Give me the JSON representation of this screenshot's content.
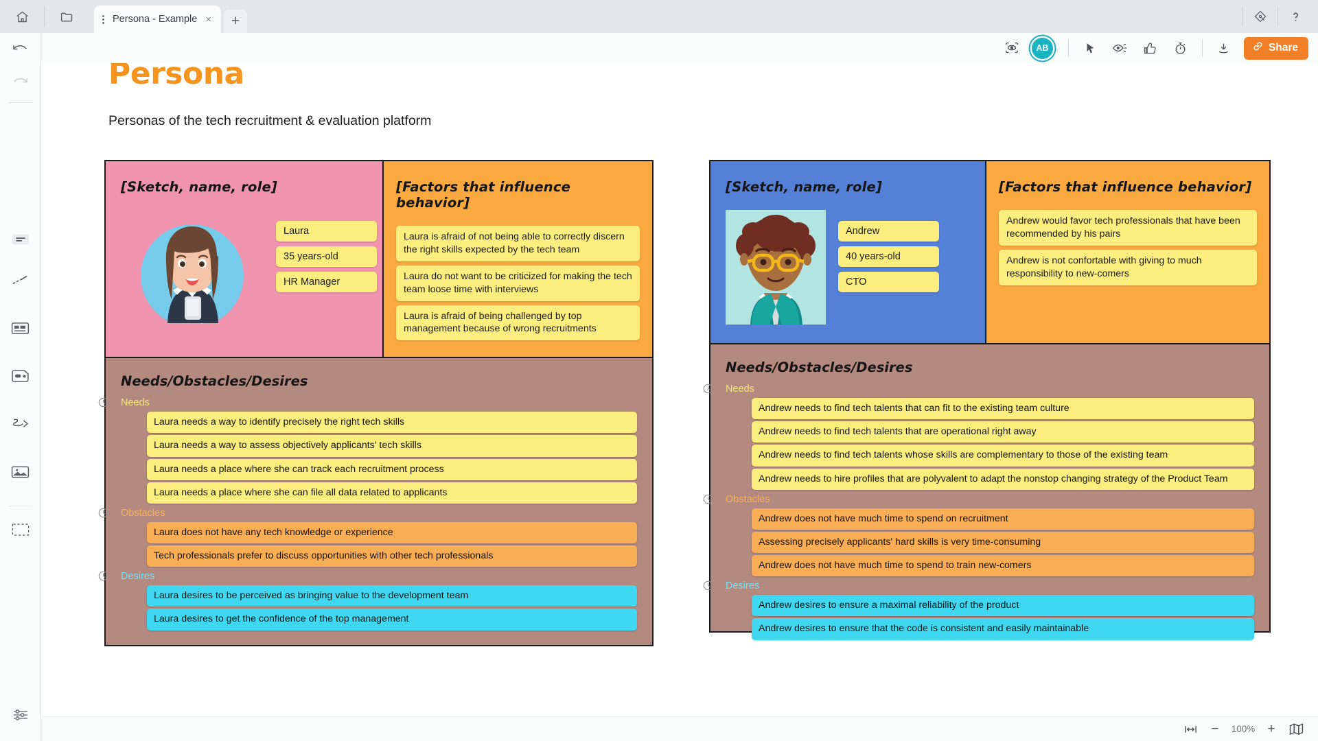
{
  "window": {
    "home_icon": "home-icon",
    "folder_icon": "folder-icon",
    "tab_title": "Persona - Example",
    "tab_close": "×",
    "new_tab": "+",
    "diamond_icon": "diamond-icon",
    "help_icon": "help-question-icon"
  },
  "toolbar": {
    "present_icon": "presentation-frame-icon",
    "avatar_initials": "AB",
    "cursor_icon": "cursor-pointer-icon",
    "eye_icon": "eye-trail-icon",
    "like_icon": "thumbs-up-icon",
    "timer_icon": "timer-icon",
    "download_icon": "download-icon",
    "share_label": "Share",
    "share_color": "#f07f27",
    "accent_color": "#1ab3c2"
  },
  "sidebar": {
    "items": [
      {
        "name": "undo-icon"
      },
      {
        "name": "redo-icon"
      },
      {
        "name": "sticky-note-icon"
      },
      {
        "name": "line-icon"
      },
      {
        "name": "card-icon"
      },
      {
        "name": "tag-icon"
      },
      {
        "name": "freehand-icon"
      },
      {
        "name": "image-icon"
      },
      {
        "name": "frame-icon"
      },
      {
        "name": "settings-sliders-icon"
      }
    ]
  },
  "canvas": {
    "title": "Persona",
    "title_color": "#f7941e",
    "subtitle": "Personas of the tech recruitment & evaluation platform"
  },
  "labels": {
    "sketch_head": "[Sketch, name, role]",
    "factors_head": "[Factors that influence behavior]",
    "nod_head": "Needs/Obstacles/Desires",
    "needs": "Needs",
    "obstacles": "Obstacles",
    "desires": "Desires"
  },
  "colors": {
    "pink_panel": "#f094b0",
    "blue_panel": "#5580d8",
    "orange_panel": "#f9a93f",
    "brown_panel": "#b4897f",
    "sticky_yellow": "#fbed7e",
    "sticky_orange": "#f9ae56",
    "sticky_cyan": "#3fd8f0"
  },
  "personas": [
    {
      "id": "laura",
      "name": "Laura",
      "age": "35 years-old",
      "role": "HR Manager",
      "factors": [
        "Laura is afraid of not being able to correctly discern the right skills expected by the tech team",
        "Laura do not want to be criticized for making the tech team loose time with interviews",
        "Laura is afraid of being challenged by top management because of wrong recruitments"
      ],
      "needs": [
        "Laura needs a way to identify precisely the right tech skills",
        "Laura needs a way to assess objectively applicants' tech skills",
        "Laura needs a place where she can track each recruitment process",
        "Laura needs a place where she can file all data related to applicants"
      ],
      "obstacles": [
        "Laura does not have any tech knowledge or experience",
        "Tech professionals prefer to discuss opportunities with other tech professionals"
      ],
      "desires": [
        "Laura desires to be perceived as bringing value to the development team",
        "Laura desires to get the confidence of the top management"
      ]
    },
    {
      "id": "andrew",
      "name": "Andrew",
      "age": "40 years-old",
      "role": "CTO",
      "factors": [
        "Andrew would favor tech professionals that have been recommended by his pairs",
        "Andrew is not confortable with giving to much responsibility to new-comers"
      ],
      "needs": [
        "Andrew needs to find tech talents that can fit to the existing team culture",
        "Andrew needs to find tech talents that are operational right away",
        "Andrew needs to find tech talents whose skills are complementary to those of the existing team",
        "Andrew needs to hire profiles that are polyvalent to adapt the nonstop changing strategy of the Product Team"
      ],
      "obstacles": [
        "Andrew does not have much time to spend on recruitment",
        "Assessing precisely applicants' hard skills is very time-consuming",
        "Andrew does not have much time to spend to train new-comers"
      ],
      "desires": [
        "Andrew desires to ensure a maximal reliability of the product",
        "Andrew desires to ensure that the code is consistent and easily maintainable"
      ]
    }
  ],
  "statusbar": {
    "fit_icon": "fit-width-icon",
    "zoom_out": "−",
    "zoom_level": "100%",
    "zoom_in": "+",
    "map_icon": "minimap-icon"
  }
}
